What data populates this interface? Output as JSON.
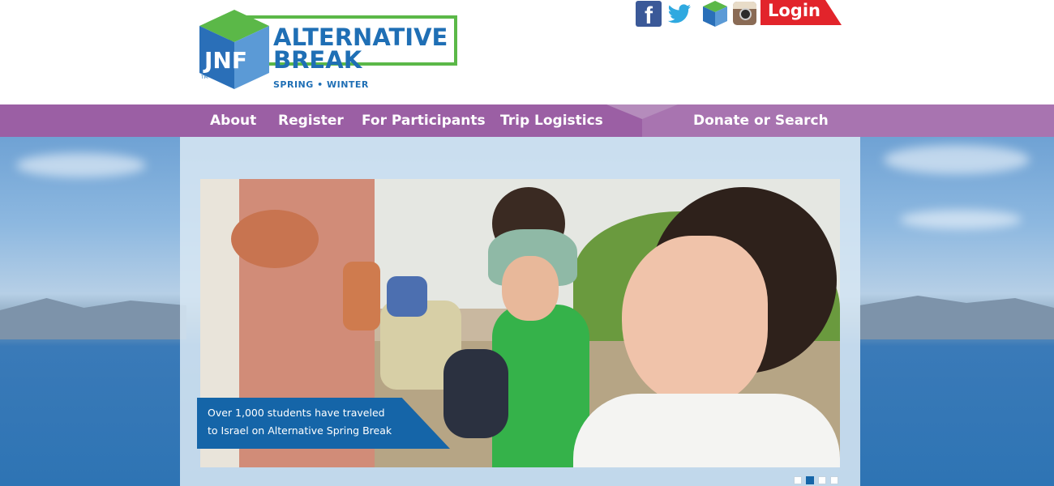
{
  "logo": {
    "line1": "ALTERNATIVE",
    "line2": "BREAK",
    "sub": "SPRING • WINTER",
    "mark_text": "JNF",
    "tm": "TM"
  },
  "social": {
    "icons": [
      "facebook-icon",
      "twitter-icon",
      "jnf-icon",
      "instagram-icon"
    ],
    "facebook_glyph": "f",
    "login_label": "Login"
  },
  "nav": {
    "items": [
      {
        "label": "About"
      },
      {
        "label": "Register"
      },
      {
        "label": "For Participants"
      },
      {
        "label": "Trip Logistics"
      }
    ],
    "right_label": "Donate or Search"
  },
  "slider": {
    "caption_line1": "Over 1,000 students have traveled",
    "caption_line2": "to Israel on Alternative Spring Break",
    "slide_count": 4,
    "active_index": 1
  },
  "colors": {
    "nav_purple": "#9b5fa4",
    "brand_blue": "#1f6fb5",
    "brand_green": "#5bb848",
    "login_red": "#e2242b",
    "caption_blue": "#1565a8"
  }
}
